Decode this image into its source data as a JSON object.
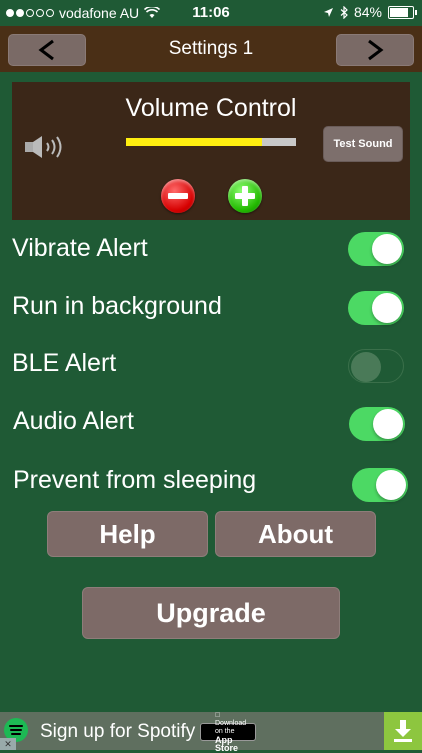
{
  "status_bar": {
    "carrier": "vodafone AU",
    "time": "11:06",
    "battery": "84%",
    "battery_level": 0.84
  },
  "nav": {
    "title": "Settings 1",
    "prev_label": "<",
    "next_label": ">"
  },
  "volume": {
    "title": "Volume Control",
    "level": 0.8,
    "test_button": "Test Sound",
    "colors": {
      "level": "#ffee10",
      "track": "#c8c8c8",
      "panel": "#3b2718"
    }
  },
  "settings": [
    {
      "label": "Vibrate Alert",
      "on": true
    },
    {
      "label": "Run in background",
      "on": true
    },
    {
      "label": "BLE Alert",
      "on": false
    },
    {
      "label": "Audio Alert",
      "on": true
    },
    {
      "label": "Prevent from sleeping",
      "on": true
    }
  ],
  "buttons": {
    "help": "Help",
    "about": "About",
    "upgrade": "Upgrade"
  },
  "ad": {
    "text": "Sign up for Spotify",
    "store_small": "Download on the",
    "store_big": "App Store"
  },
  "colors": {
    "background": "#1f5a35",
    "navbar": "#4a2f16",
    "toggle_on": "#4cd964",
    "button": "#7d6a67"
  }
}
